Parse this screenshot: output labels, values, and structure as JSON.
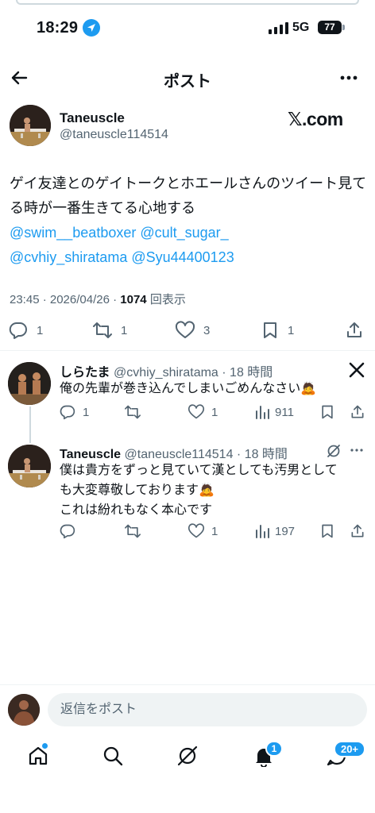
{
  "status_bar": {
    "time": "18:29",
    "network": "5G",
    "battery": "77"
  },
  "header": {
    "title": "ポスト"
  },
  "post": {
    "author_name": "Taneuscle",
    "author_handle": "@taneuscle114514",
    "source_label": "𝕏.com",
    "text": "ゲイ友達とのゲイトークとホエールさんのツイート見てる時が一番生きてる心地する",
    "mentions_line1": "@swim__beatboxer @cult_sugar_",
    "mentions_line2": "@cvhiy_shiratama  @Syu44400123",
    "timestamp": "23:45 · 2026/04/26 · ",
    "views_count": "1074",
    "views_label": "回表示",
    "stats": {
      "replies": "1",
      "reposts": "1",
      "likes": "3",
      "bookmarks": "1"
    }
  },
  "replies": [
    {
      "name": "しらたま",
      "handle": "@cvhiy_shiratama · 18 時間",
      "text": "俺の先輩が巻き込んでしまいごめんなさい🙇",
      "replies": "1",
      "reposts": "",
      "likes": "1",
      "views": "911"
    },
    {
      "name": "Taneuscle",
      "handle": "@taneuscle114514 · 18 時間",
      "text_line1": "僕は貴方をずっと見ていて漢としても汚男として",
      "text_line2": "も大変尊敬しております🙇",
      "text_line3": "これは紛れもなく本心です",
      "replies": "",
      "reposts": "",
      "likes": "1",
      "views": "197"
    }
  ],
  "composer": {
    "placeholder": "返信をポスト"
  },
  "nav": {
    "notifications_badge": "1",
    "messages_badge": "20+"
  },
  "colors": {
    "accent": "#1d9bf0",
    "text": "#0f1419",
    "muted": "#536471"
  }
}
